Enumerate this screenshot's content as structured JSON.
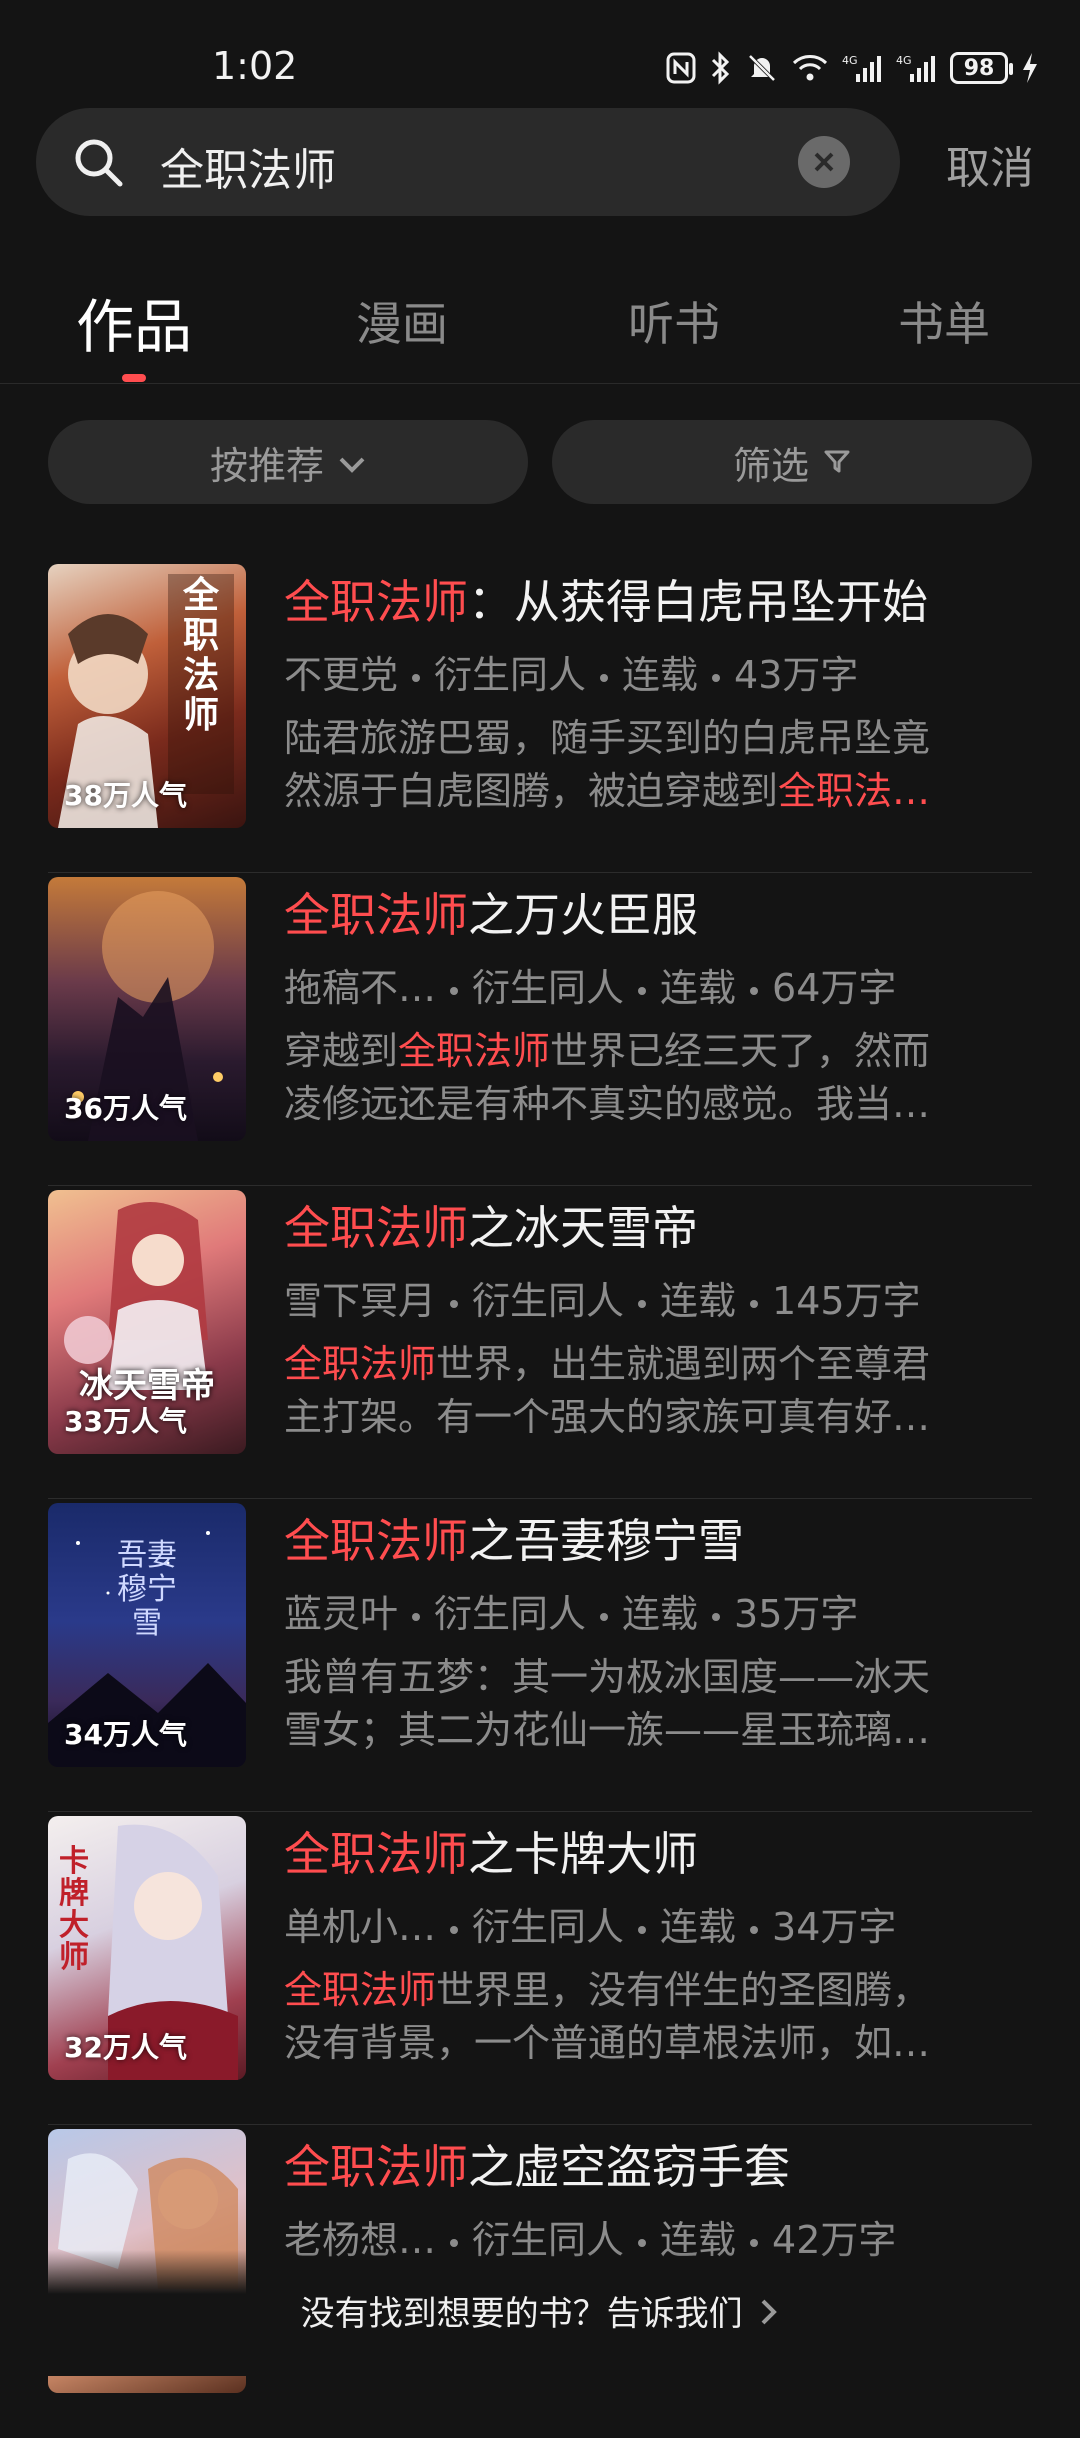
{
  "status_bar": {
    "time": "1:02",
    "battery": "98"
  },
  "search": {
    "query": "全职法师",
    "cancel_label": "取消"
  },
  "tabs": [
    {
      "label": "作品",
      "active": true
    },
    {
      "label": "漫画",
      "active": false
    },
    {
      "label": "听书",
      "active": false
    },
    {
      "label": "书单",
      "active": false
    }
  ],
  "filters": {
    "sort_label": "按推荐",
    "filter_label": "筛选"
  },
  "results": [
    {
      "title_hl": "全职法师",
      "title_rest": "：从获得白虎吊坠开始",
      "author": "不更党",
      "category": "衍生同人",
      "status": "连载",
      "words": "43万字",
      "desc1": "陆君旅游巴蜀，随手买到的白虎吊坠竟",
      "desc2_pre": "然源于白虎图腾，被迫穿越到",
      "desc2_hl": "全职法…",
      "desc2_post": "",
      "popularity": "38万人气",
      "cover_text": "全职法师"
    },
    {
      "title_hl": "全职法师",
      "title_rest": "之万火臣服",
      "author": "拖稿不…",
      "category": "衍生同人",
      "status": "连载",
      "words": "64万字",
      "desc1_pre": "穿越到",
      "desc1_hl": "全职法师",
      "desc1_post": "世界已经三天了，然而",
      "desc2": "凌修远还是有种不真实的感觉。我当…",
      "popularity": "36万人气"
    },
    {
      "title_hl": "全职法师",
      "title_rest": "之冰天雪帝",
      "author": "雪下冥月",
      "category": "衍生同人",
      "status": "连载",
      "words": "145万字",
      "desc1_hl": "全职法师",
      "desc1_post": "世界，出生就遇到两个至尊君",
      "desc2": "主打架。有一个强大的家族可真有好…",
      "popularity": "33万人气",
      "cover_text": "冰天雪帝"
    },
    {
      "title_hl": "全职法师",
      "title_rest": "之吾妻穆宁雪",
      "author": "蓝灵叶",
      "category": "衍生同人",
      "status": "连载",
      "words": "35万字",
      "desc1": "我曾有五梦：其一为极冰国度——冰天",
      "desc2": "雪女；其二为花仙一族——星玉琉璃…",
      "popularity": "34万人气",
      "cover_text": "吾妻穆宁雪"
    },
    {
      "title_hl": "全职法师",
      "title_rest": "之卡牌大师",
      "author": "单机小…",
      "category": "衍生同人",
      "status": "连载",
      "words": "34万字",
      "desc1_hl": "全职法师",
      "desc1_post": "世界里，没有伴生的圣图腾，",
      "desc2": "没有背景，一个普通的草根法师，如…",
      "popularity": "32万人气",
      "cover_text": "卡牌大师"
    },
    {
      "title_hl": "全职法师",
      "title_rest": "之虚空盗窃手套",
      "author": "老杨想…",
      "category": "衍生同人",
      "status": "连载",
      "words": "42万字"
    }
  ],
  "footer": {
    "tip": "没有找到想要的书？告诉我们"
  },
  "colors": {
    "accent": "#ff4d4f",
    "background": "#141414",
    "muted": "#8c8c8c"
  }
}
